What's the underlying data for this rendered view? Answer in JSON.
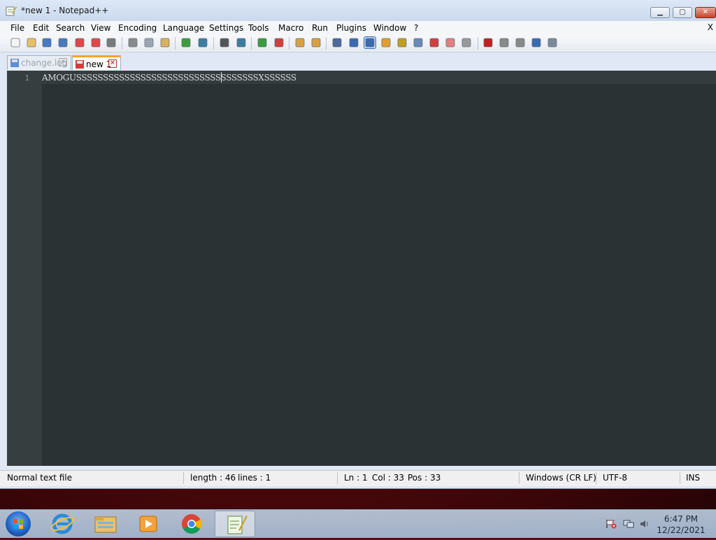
{
  "window": {
    "title": "*new 1 - Notepad++",
    "minimize_icon": "minimize-icon",
    "maximize_icon": "maximize-icon",
    "close_label": "X"
  },
  "menu": {
    "items": [
      "File",
      "Edit",
      "Search",
      "View",
      "Encoding",
      "Language",
      "Settings",
      "Tools",
      "Macro",
      "Run",
      "Plugins",
      "Window",
      "?"
    ],
    "close_doc": "X"
  },
  "toolbar": {
    "icons": [
      "new-file-icon",
      "open-file-icon",
      "save-icon",
      "save-all-icon",
      "close-icon",
      "close-all-icon",
      "print-icon",
      "cut-icon",
      "copy-icon",
      "paste-icon",
      "undo-icon",
      "redo-icon",
      "find-icon",
      "replace-icon",
      "zoom-in-icon",
      "zoom-out-icon",
      "sync-vertical-icon",
      "sync-horizontal-icon",
      "word-wrap-icon",
      "show-all-chars-icon",
      "indent-guide-icon",
      "document-map-icon",
      "function-list-icon",
      "folder-workspace-icon",
      "monitoring-icon",
      "doc-list-icon",
      "clipboard-history-icon",
      "record-macro-icon",
      "stop-macro-icon",
      "play-macro-icon",
      "run-macro-multiple-icon",
      "save-macro-icon"
    ]
  },
  "tabs": [
    {
      "label": "change.log",
      "active": false
    },
    {
      "label": "new 1",
      "active": true
    }
  ],
  "editor": {
    "line_number": "1",
    "content": "AMOGUSSSSSSSSSSSSSSSSSSSSSSSSSSSSSSSSSSXSSSSSS",
    "background": "#2b3234"
  },
  "status": {
    "file_type": "Normal text file",
    "length": "length : 46",
    "lines": "lines : 1",
    "ln": "Ln : 1",
    "col": "Col : 33",
    "pos": "Pos : 33",
    "eol": "Windows (CR LF)",
    "encoding": "UTF-8",
    "mode": "INS"
  },
  "taskbar": {
    "apps": [
      "internet-explorer-icon",
      "file-explorer-icon",
      "media-player-icon",
      "chrome-icon",
      "notepad-plus-plus-icon"
    ],
    "time": "6:47 PM",
    "date": "12/22/2021"
  }
}
